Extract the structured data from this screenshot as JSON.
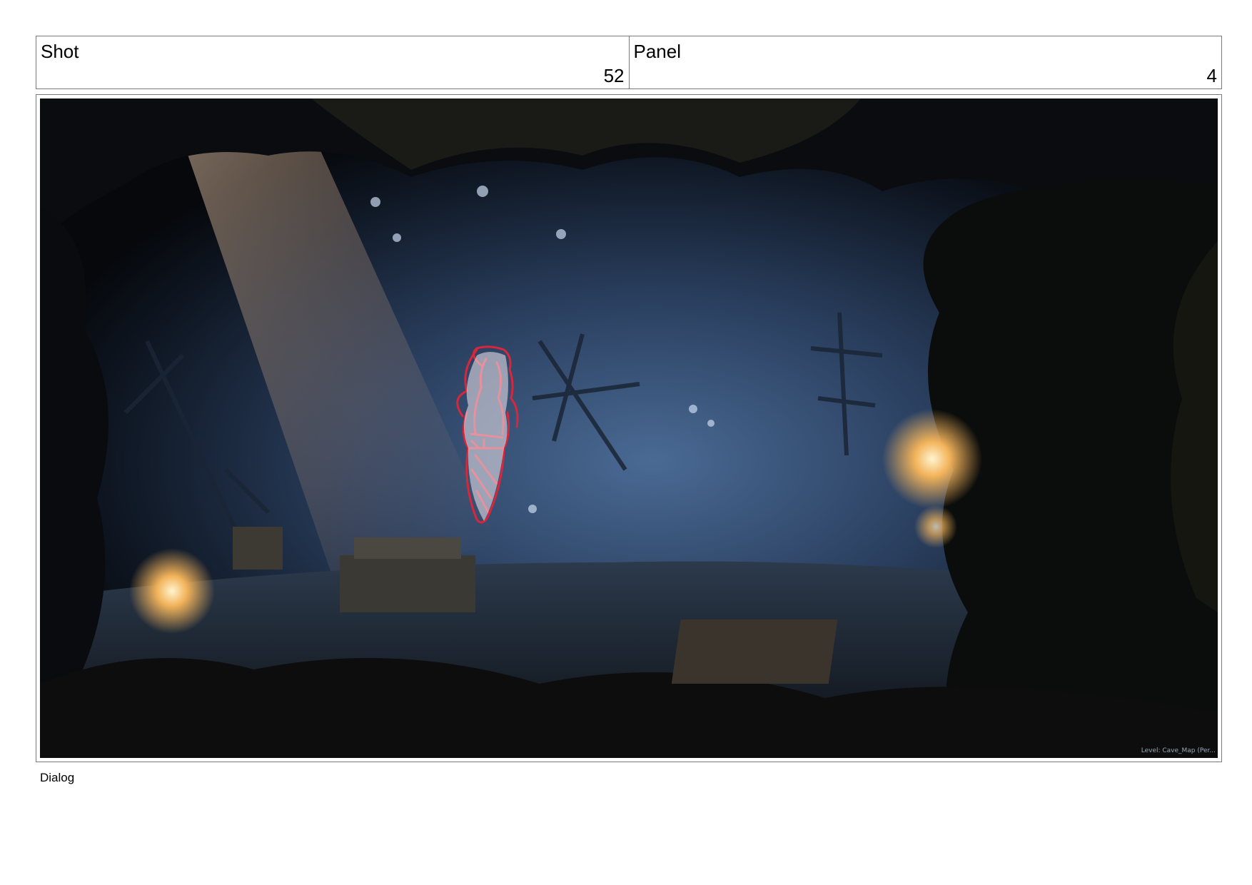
{
  "header": {
    "shot_label": "Shot",
    "shot_number": "52",
    "panel_label": "Panel",
    "panel_number": "4"
  },
  "frame": {
    "hud_text": "Level: Cave_Map (Per..."
  },
  "dialog": {
    "label": "Dialog"
  }
}
